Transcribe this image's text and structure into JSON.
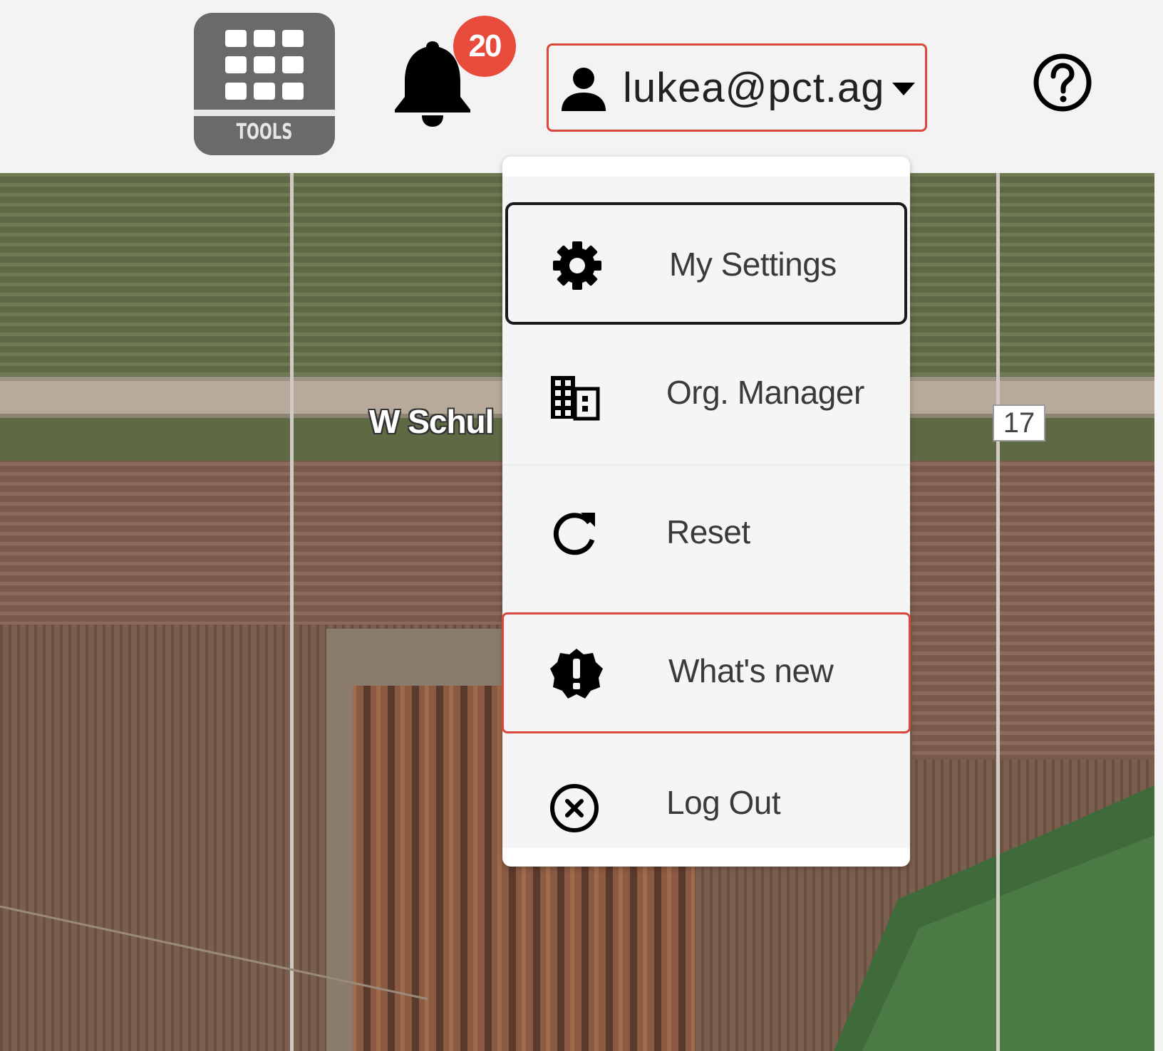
{
  "topbar": {
    "tools_label": "TOOLS",
    "notification_count": "20",
    "user_email": "lukea@pct.ag"
  },
  "map": {
    "road_label": "W Schul",
    "route_marker": "17"
  },
  "user_menu": {
    "items": [
      {
        "label": "My Settings",
        "icon": "gear-icon"
      },
      {
        "label": "Org. Manager",
        "icon": "building-icon"
      },
      {
        "label": "Reset",
        "icon": "refresh-icon"
      },
      {
        "label": "What's new",
        "icon": "alert-badge-icon"
      },
      {
        "label": "Log Out",
        "icon": "close-circle-icon"
      }
    ]
  },
  "colors": {
    "highlight_border": "#d9483b",
    "badge": "#e84b3c",
    "tools_bg": "#6a6a6a",
    "topbar_bg": "#f3f3f3"
  }
}
